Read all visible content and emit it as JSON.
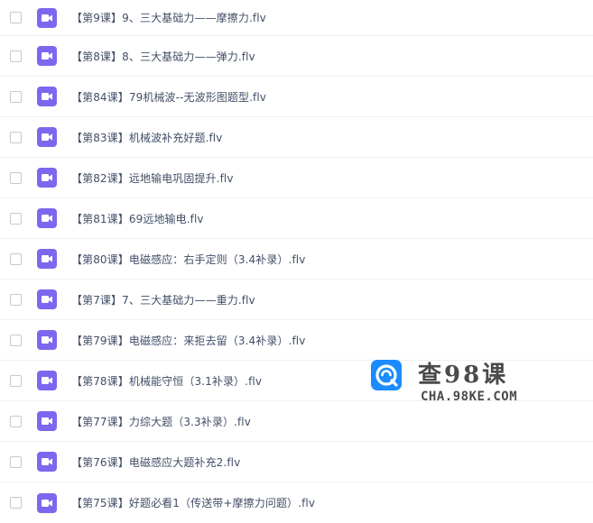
{
  "files": [
    {
      "name": "【第9课】9、三大基础力——摩擦力.flv"
    },
    {
      "name": "【第8课】8、三大基础力——弹力.flv"
    },
    {
      "name": "【第84课】79机械波--无波形图题型.flv"
    },
    {
      "name": "【第83课】机械波补充好题.flv"
    },
    {
      "name": "【第82课】远地输电巩固提升.flv"
    },
    {
      "name": "【第81课】69远地输电.flv"
    },
    {
      "name": "【第80课】电磁感应：右手定则（3.4补录）.flv"
    },
    {
      "name": "【第7课】7、三大基础力——重力.flv"
    },
    {
      "name": "【第79课】电磁感应：来拒去留（3.4补录）.flv"
    },
    {
      "name": "【第78课】机械能守恒（3.1补录）.flv"
    },
    {
      "name": "【第77课】力综大题（3.3补录）.flv"
    },
    {
      "name": "【第76课】电磁感应大题补充2.flv"
    },
    {
      "name": "【第75课】好题必看1（传送带+摩擦力问题）.flv"
    }
  ],
  "icons": {
    "row_checkbox": "checkbox",
    "file_type": "video-file-icon",
    "watermark_logo": "search-q-logo"
  },
  "colors": {
    "video_icon": "#7b68ee",
    "text": "#424e67",
    "watermark_logo": "#1a8cff"
  },
  "watermark": {
    "title": "查98课",
    "url": "CHA.98KE.COM"
  }
}
